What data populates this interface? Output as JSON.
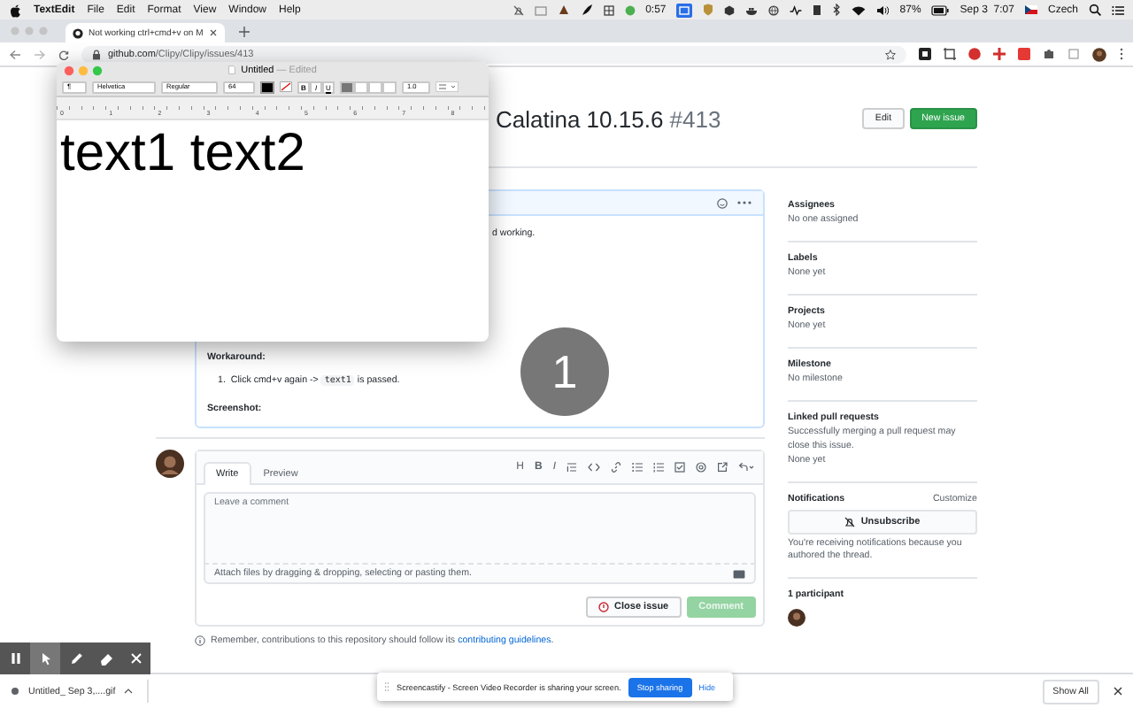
{
  "menu_bar": {
    "app": "TextEdit",
    "menus": [
      "File",
      "Edit",
      "Format",
      "View",
      "Window",
      "Help"
    ],
    "timer": "0:57",
    "battery": "87%",
    "clock": "Sep 3  7:07",
    "input_source": "Czech"
  },
  "browser": {
    "tabs": [
      {
        "title": "Not working ctrl+cmd+v on M",
        "selected": true
      }
    ],
    "url_host": "github.com",
    "url_path": "/Clipy/Clipy/issues/413"
  },
  "issue": {
    "title": "Calatina 10.15.6",
    "number": "#413",
    "buttons": [
      {
        "label": "Edit",
        "kind": "secondary"
      },
      {
        "label": "New issue",
        "kind": "primary"
      }
    ],
    "body": {
      "partial_line": "d working.",
      "workaround_heading": "Workaround:",
      "steps": [
        {
          "marker": "1.",
          "before": "Click cmd+v again ->",
          "code": "text1",
          "after": "is passed."
        }
      ],
      "screenshot_heading": "Screenshot:"
    },
    "sidebar": [
      {
        "heading": "Assignees",
        "lines": [
          "No one assigned"
        ]
      },
      {
        "heading": "Labels",
        "lines": [
          "None yet"
        ]
      },
      {
        "heading": "Projects",
        "lines": [
          "None yet"
        ]
      },
      {
        "heading": "Milestone",
        "lines": [
          "No milestone"
        ]
      },
      {
        "heading": "Linked pull requests",
        "lines": [
          "Successfully merging a pull request may close this issue.",
          "None yet"
        ]
      }
    ],
    "notifications": {
      "heading": "Notifications",
      "action": "Customize",
      "button": "Unsubscribe",
      "note": "You're receiving notifications because you authored the thread."
    },
    "participants": "1 participant",
    "comment": {
      "tabs": [
        {
          "label": "Write",
          "selected": true
        },
        {
          "label": "Preview",
          "selected": false
        }
      ],
      "toolbar_letters": [
        {
          "label": "H",
          "kind": "heading"
        },
        {
          "label": "B",
          "kind": "bold"
        },
        {
          "label": "I",
          "kind": "italic"
        }
      ],
      "placeholder": "Leave a comment",
      "attach": "Attach files by dragging & dropping, selecting or pasting them.",
      "close_button": "Close issue",
      "submit_button": {
        "label": "Comment",
        "disabled": true
      }
    },
    "guidelines": {
      "text": "Remember, contributions to this repository should follow its",
      "link": "contributing guidelines",
      "end": "."
    }
  },
  "click_marker": "1",
  "text_edit": {
    "title": "Untitled",
    "status": "— Edited",
    "paragraph_style": "¶",
    "font": "Helvetica",
    "typeface": "Regular",
    "size": "64",
    "styles": [
      "B",
      "I",
      "U"
    ],
    "alignment": [
      {
        "selected": true
      },
      {
        "selected": false
      },
      {
        "selected": false
      },
      {
        "selected": false
      }
    ],
    "spacing": "1.0",
    "ruler": [
      "0",
      "1",
      "2",
      "3",
      "4",
      "5",
      "6",
      "7",
      "8"
    ],
    "content": "text1 text2"
  },
  "annotation_tools": [
    {
      "kind": "pause",
      "selected": false
    },
    {
      "kind": "pointer",
      "selected": true
    },
    {
      "kind": "pen",
      "selected": false
    },
    {
      "kind": "eraser",
      "selected": false
    },
    {
      "kind": "close",
      "selected": false
    }
  ],
  "downloads": {
    "items": [
      {
        "name": "Untitled_ Sep 3,....gif"
      }
    ],
    "show_all": "Show All"
  },
  "share_notice": {
    "text": "Screencastify - Screen Video Recorder is sharing your screen.",
    "stop": "Stop sharing",
    "hide": "Hide"
  }
}
